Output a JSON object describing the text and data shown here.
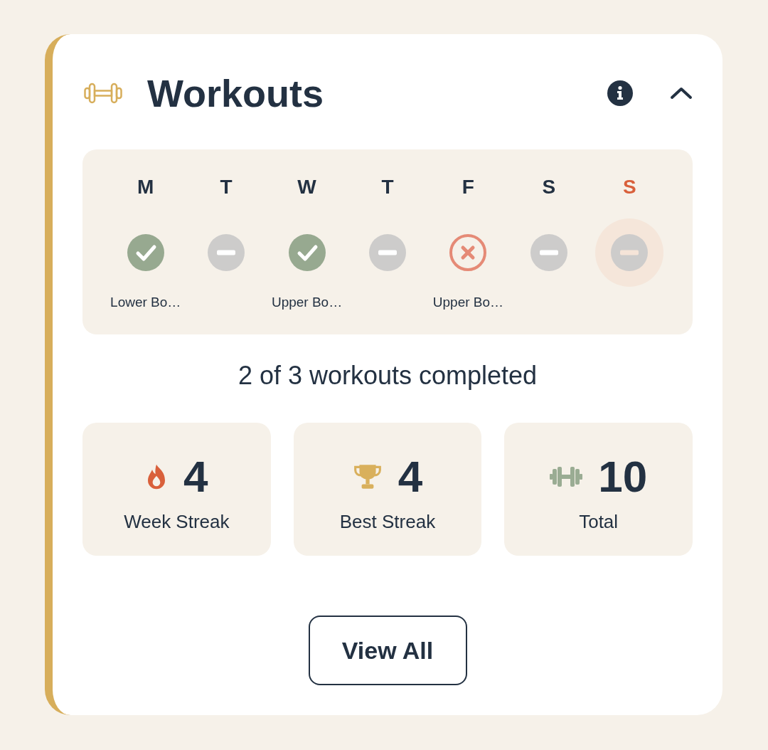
{
  "card": {
    "title": "Workouts",
    "expanded": true
  },
  "days": [
    {
      "letter": "M",
      "kind": "done",
      "workout": "Lower Bo…",
      "today": false
    },
    {
      "letter": "T",
      "kind": "rest",
      "today": false
    },
    {
      "letter": "W",
      "kind": "done",
      "workout": "Upper Bo…",
      "today": false
    },
    {
      "letter": "T",
      "kind": "rest",
      "today": false
    },
    {
      "letter": "F",
      "kind": "missed",
      "workout": "Upper Bo…",
      "today": false
    },
    {
      "letter": "S",
      "kind": "rest",
      "today": false
    },
    {
      "letter": "S",
      "kind": "rest",
      "today": true
    }
  ],
  "summary": "2 of 3 workouts completed",
  "stats": [
    {
      "kind": "week_streak",
      "value": "4",
      "label": "Week Streak"
    },
    {
      "kind": "best_streak",
      "value": "4",
      "label": "Best Streak"
    },
    {
      "kind": "total",
      "value": "10",
      "label": "Total"
    }
  ],
  "button": "View All"
}
